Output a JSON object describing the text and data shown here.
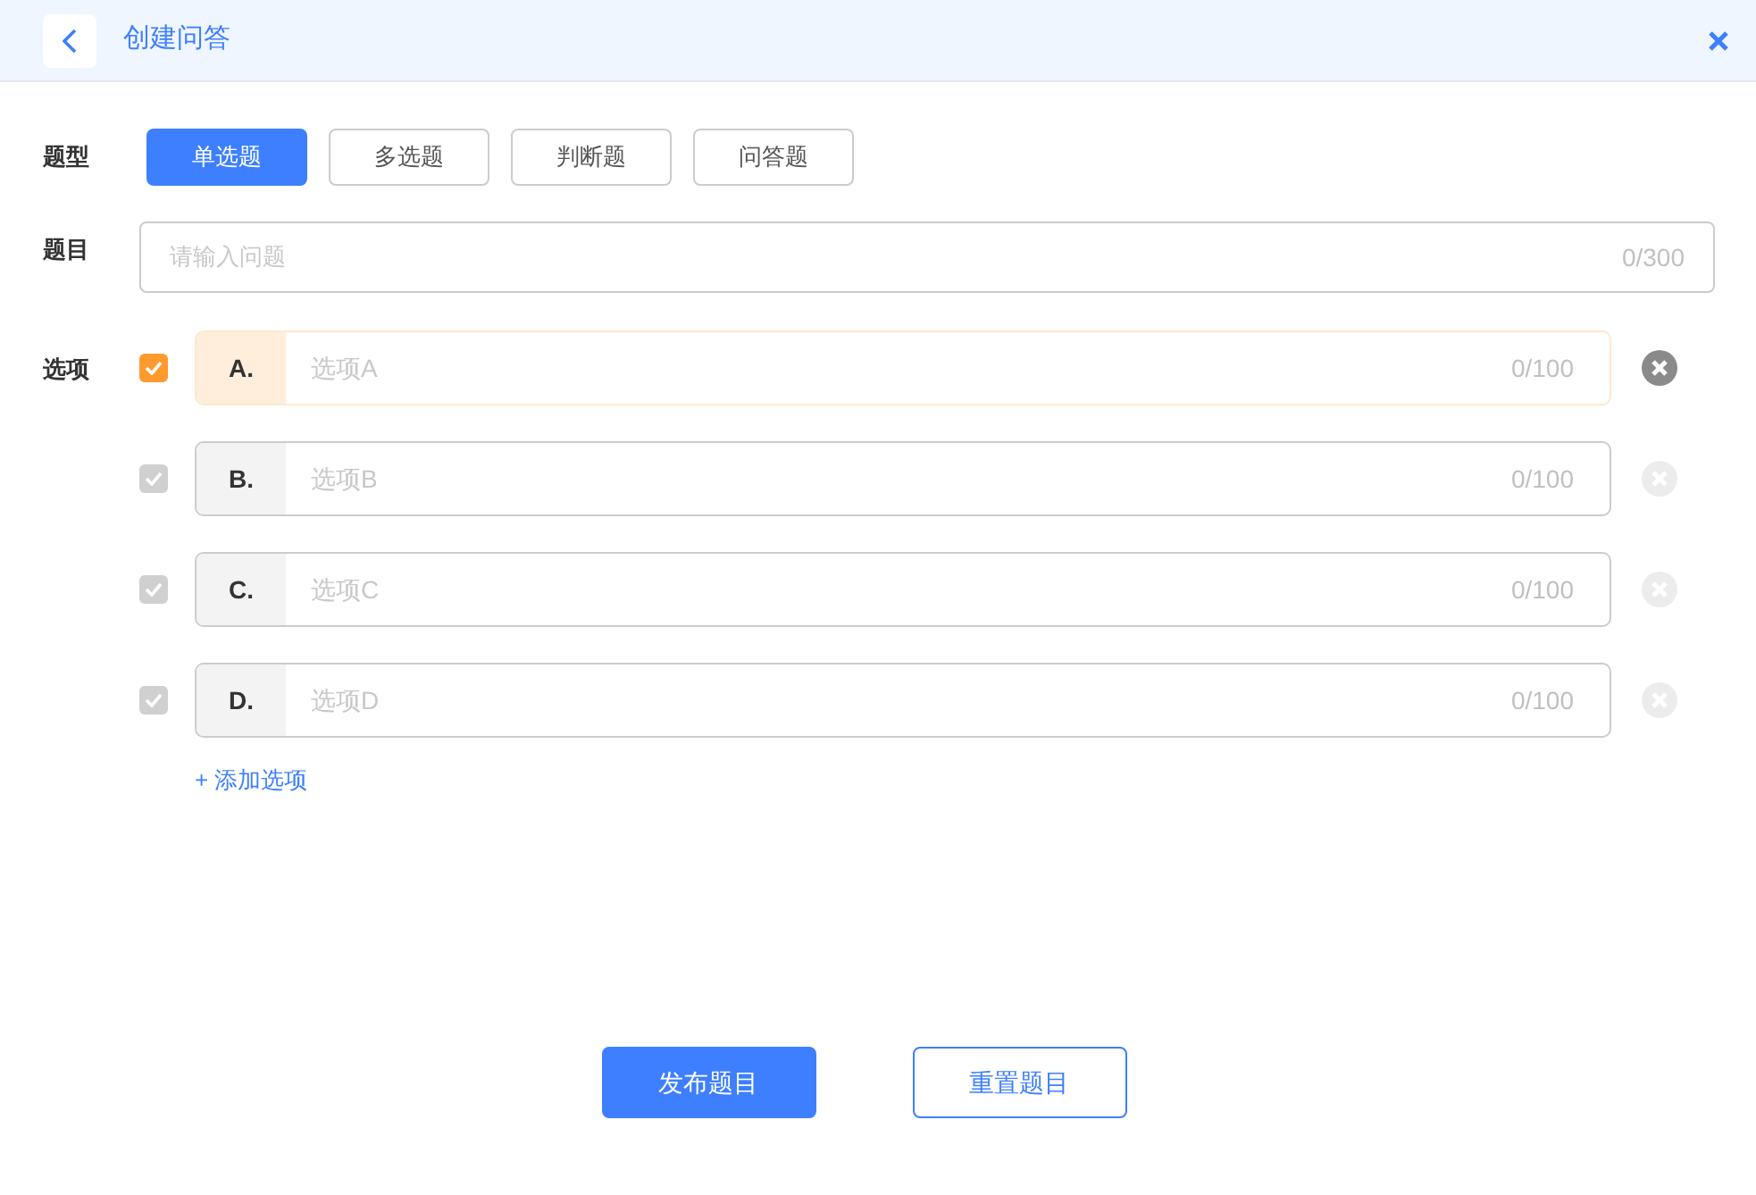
{
  "header": {
    "title": "创建问答"
  },
  "type_field": {
    "label": "题型",
    "options": [
      {
        "label": "单选题",
        "selected": true
      },
      {
        "label": "多选题",
        "selected": false
      },
      {
        "label": "判断题",
        "selected": false
      },
      {
        "label": "问答题",
        "selected": false
      }
    ]
  },
  "question_field": {
    "label": "题目",
    "placeholder": "请输入问题",
    "counter": "0/300"
  },
  "options_field": {
    "label": "选项",
    "options": [
      {
        "letter": "A.",
        "placeholder": "选项A",
        "counter": "0/100",
        "checked": true
      },
      {
        "letter": "B.",
        "placeholder": "选项B",
        "counter": "0/100",
        "checked": false
      },
      {
        "letter": "C.",
        "placeholder": "选项C",
        "counter": "0/100",
        "checked": false
      },
      {
        "letter": "D.",
        "placeholder": "选项D",
        "counter": "0/100",
        "checked": false
      }
    ],
    "add_link": "+ 添加选项"
  },
  "buttons": [
    {
      "kind": "primary",
      "label": "发布题目"
    },
    {
      "kind": "outline",
      "label": "重置题目"
    }
  ]
}
